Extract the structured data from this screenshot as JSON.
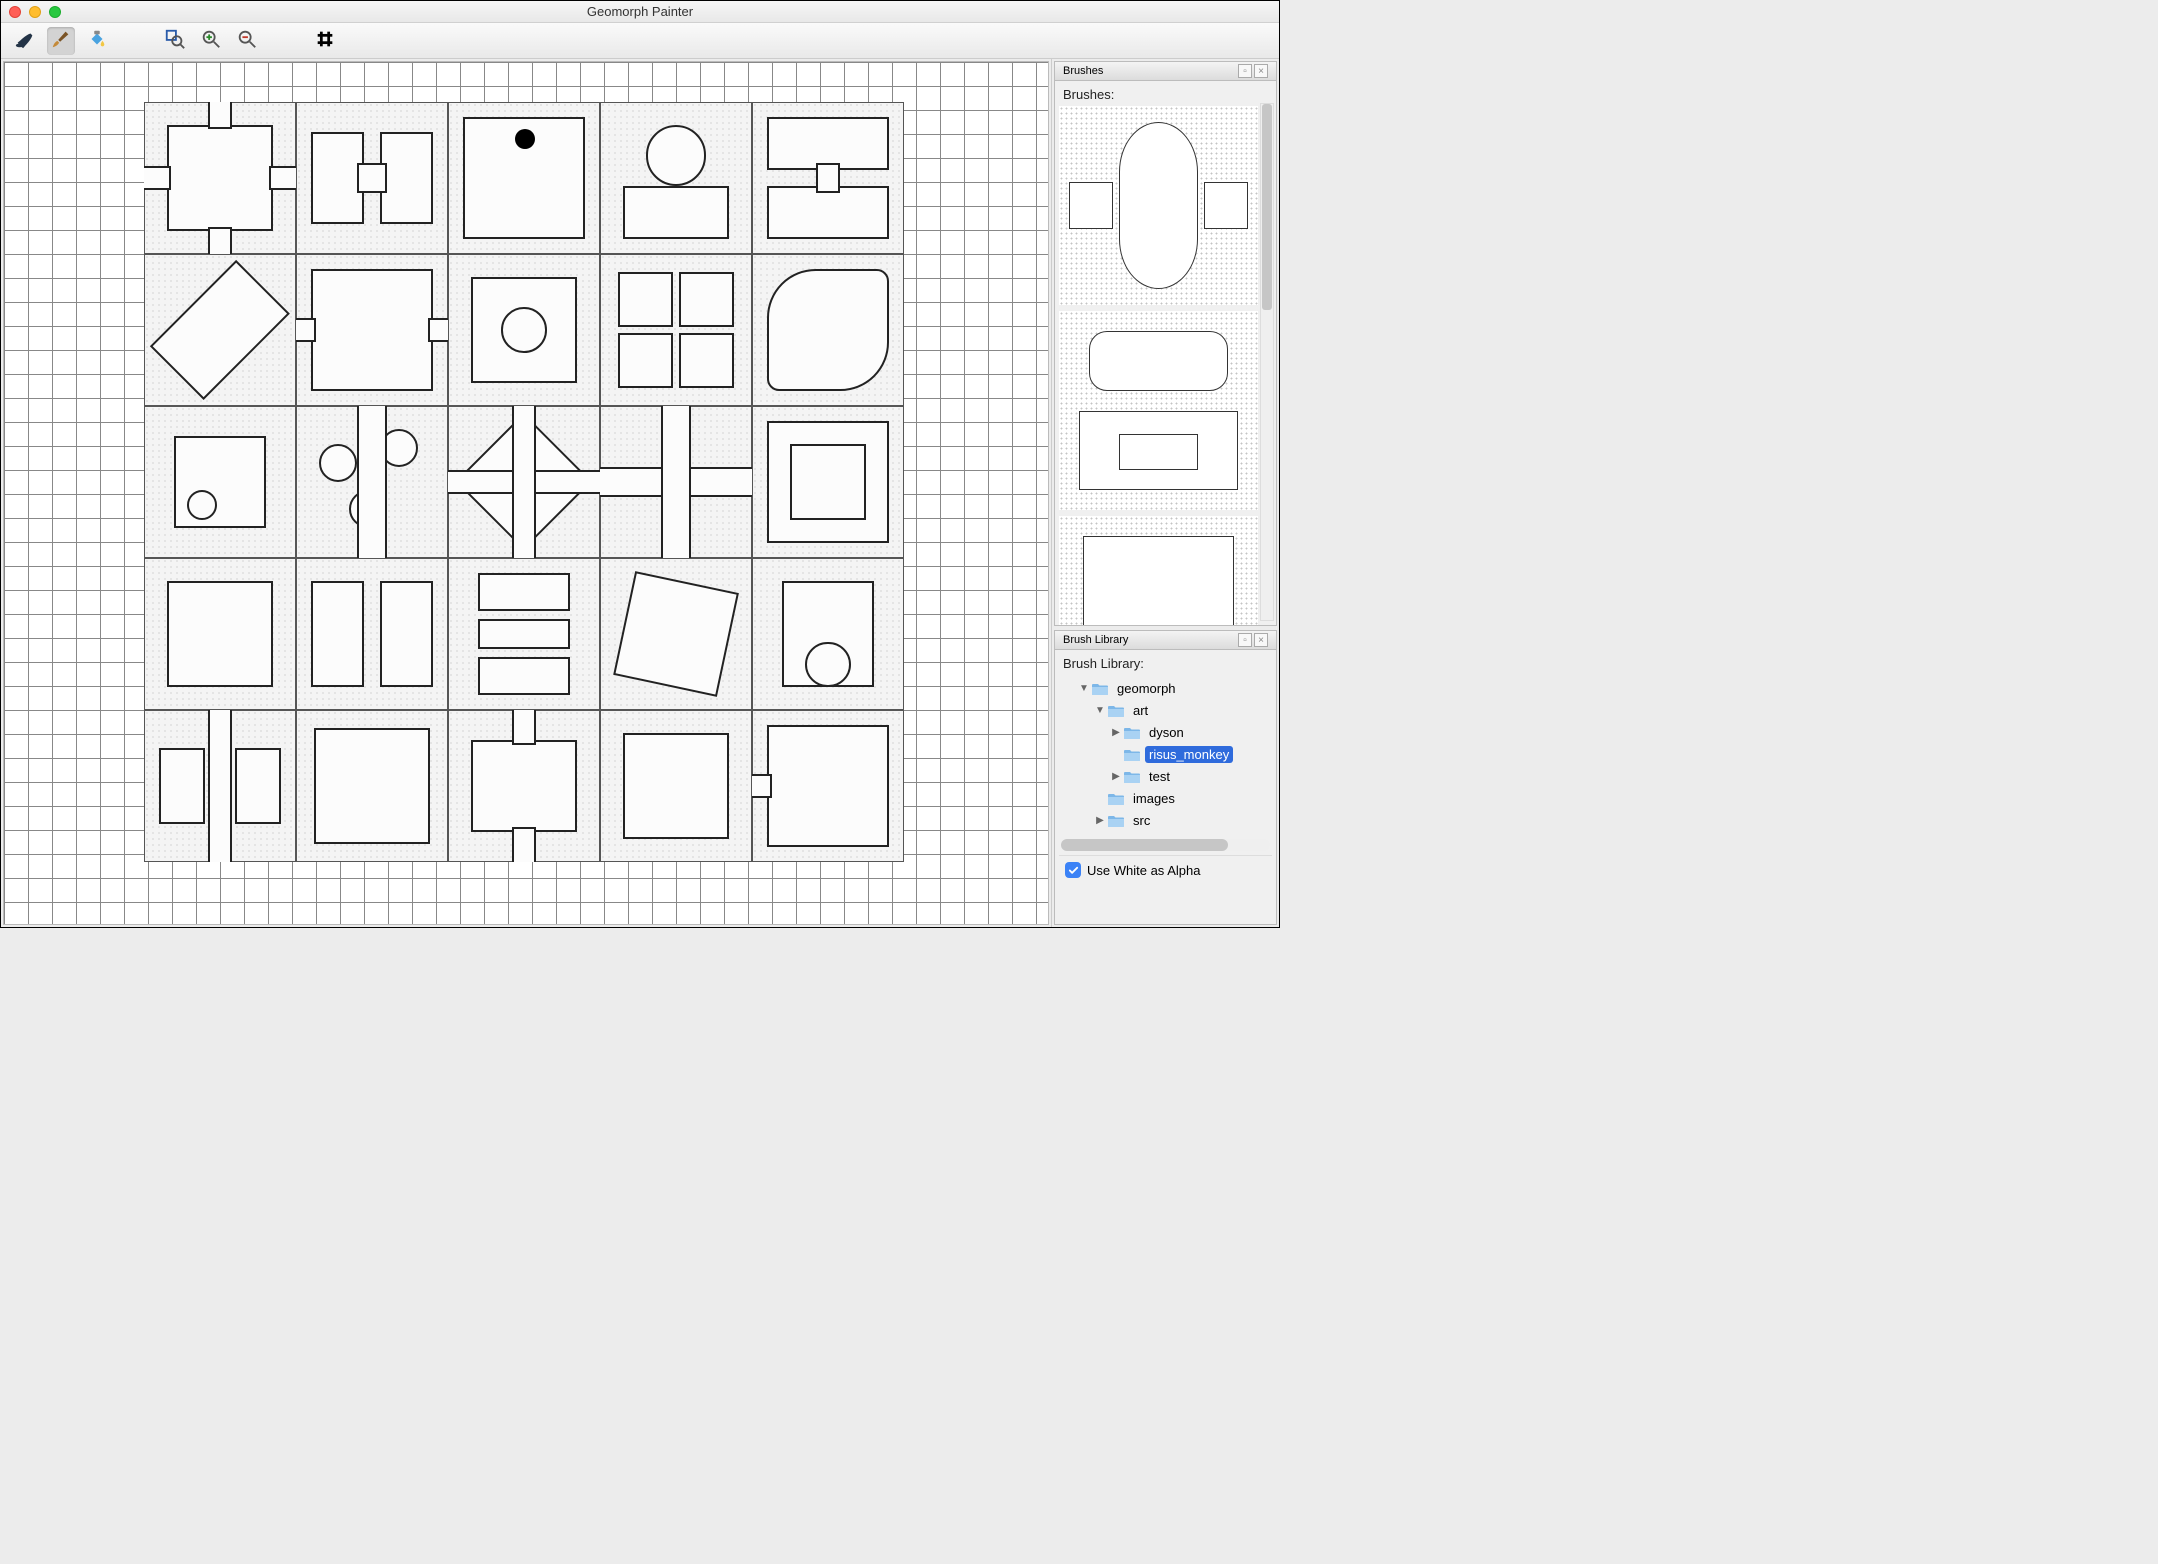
{
  "title": "Geomorph Painter",
  "toolbar": {
    "stamp_tool": "stamp",
    "brush_tool": "brush",
    "bucket_tool": "bucket",
    "zoom_fit": "zoom-fit",
    "zoom_in": "zoom-in",
    "zoom_out": "zoom-out",
    "grid_tool": "grid"
  },
  "panels": {
    "brushes": {
      "title": "Brushes",
      "label": "Brushes:"
    },
    "library": {
      "title": "Brush Library",
      "label": "Brush Library:",
      "tree": [
        {
          "level": 1,
          "expanded": true,
          "hasChildren": true,
          "name": "geomorph"
        },
        {
          "level": 2,
          "expanded": true,
          "hasChildren": true,
          "name": "art"
        },
        {
          "level": 3,
          "expanded": false,
          "hasChildren": true,
          "name": "dyson"
        },
        {
          "level": 3,
          "expanded": false,
          "hasChildren": false,
          "name": "risus_monkey",
          "selected": true
        },
        {
          "level": 3,
          "expanded": false,
          "hasChildren": true,
          "name": "test"
        },
        {
          "level": 2,
          "expanded": false,
          "hasChildren": false,
          "name": "images"
        },
        {
          "level": 2,
          "expanded": false,
          "hasChildren": true,
          "name": "src"
        }
      ],
      "checkbox_label": "Use White as Alpha",
      "checkbox_checked": true
    }
  }
}
